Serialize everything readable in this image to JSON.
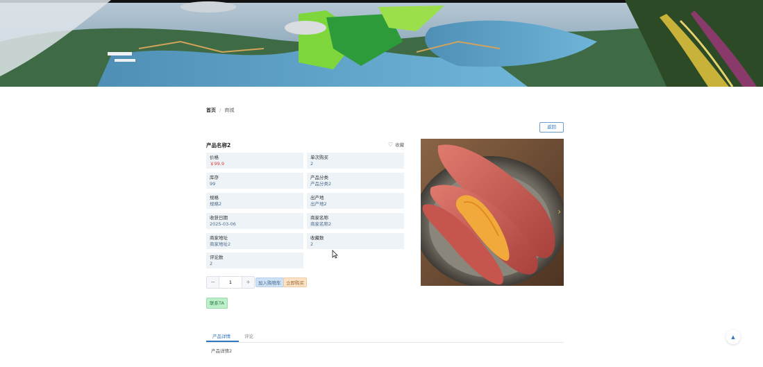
{
  "breadcrumb": {
    "home": "首页",
    "current": "商城"
  },
  "actions": {
    "back": "返回"
  },
  "product": {
    "name": "产品名称2",
    "favorite": "收藏",
    "favorite_icon": "heart-outline-icon",
    "attributes": [
      {
        "label": "价格",
        "value": "￥99.9",
        "highlight": true
      },
      {
        "label": "单次购买",
        "value": "2"
      },
      {
        "label": "库存",
        "value": "99"
      },
      {
        "label": "产品分类",
        "value": "产品分类2"
      },
      {
        "label": "规格",
        "value": "规格2"
      },
      {
        "label": "出产地",
        "value": "出产地2"
      },
      {
        "label": "收获日期",
        "value": "2025-03-06"
      },
      {
        "label": "商家名称",
        "value": "商家名称2"
      },
      {
        "label": "商家地址",
        "value": "商家地址2"
      },
      {
        "label": "收藏数",
        "value": "2"
      },
      {
        "label": "评论数",
        "value": "2"
      }
    ],
    "quantity": "1",
    "minus": "−",
    "plus": "+",
    "add_to_cart": "加入购物车",
    "buy_now": "立即购买",
    "contact": "联系TA"
  },
  "tabs": [
    {
      "label": "产品详情",
      "active": true
    },
    {
      "label": "评论",
      "active": false
    }
  ],
  "tab_content": "产品详情2",
  "colors": {
    "accent": "#2f74c0",
    "price": "#e23b3b",
    "cell_bg": "#eef3f8"
  }
}
